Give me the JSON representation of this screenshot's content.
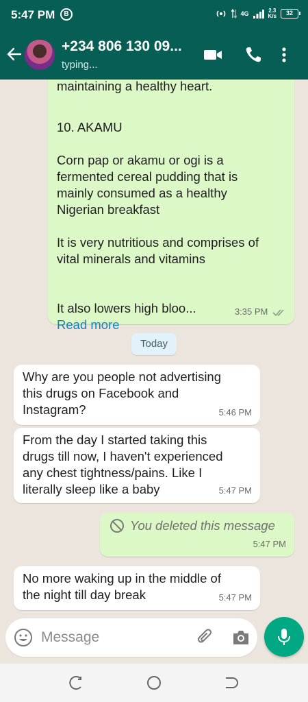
{
  "status_bar": {
    "time": "5:47 PM",
    "badge": "B",
    "network_label": "4G",
    "speed_value": "2.3",
    "speed_unit": "K/s",
    "battery": "32"
  },
  "header": {
    "contact_name": "+234 806 130 09...",
    "contact_status": "typing..."
  },
  "chat": {
    "top_message": {
      "line_1": "maintaining a healthy heart.",
      "heading": "10. AKAMU",
      "paragraph_1": "Corn pap or akamu or ogi is a\nfermented cereal pudding that is\nmainly consumed as a healthy\nNigerian breakfast",
      "paragraph_2": "It is very nutritious and comprises of\nvital minerals and vitamins",
      "paragraph_3": "It also lowers high bloo...",
      "read_more": "Read more",
      "time": "3:35 PM"
    },
    "date_separator": "Today",
    "messages": [
      {
        "text": "Why are you people not advertising\nthis drugs on Facebook and\nInstagram?",
        "time": "5:46 PM"
      },
      {
        "text": "From the day I started taking this\ndrugs till now, I haven't experienced\nany chest tightness/pains. Like I\nliterally sleep like a baby",
        "time": "5:47 PM"
      },
      {
        "text": "You deleted this message",
        "time": "5:47 PM"
      },
      {
        "text": "No more waking up in the middle of\nthe night till day break",
        "time": "5:47 PM"
      }
    ]
  },
  "input": {
    "placeholder": "Message"
  },
  "icons": {
    "back": "arrow-left",
    "video": "video-camera",
    "call": "phone",
    "menu": "three-dots-vertical",
    "emoji": "smiley",
    "attach": "paperclip",
    "camera": "camera",
    "mic": "microphone",
    "deleted": "prohibited-circle"
  },
  "colors": {
    "header": "#075e54",
    "outgoing_bubble": "#dcf8c6",
    "incoming_bubble": "#ffffff",
    "chat_background": "#ece5dd",
    "mic_button": "#00a884",
    "link": "#1a7fb5",
    "date_pill": "#e1f2fb"
  }
}
